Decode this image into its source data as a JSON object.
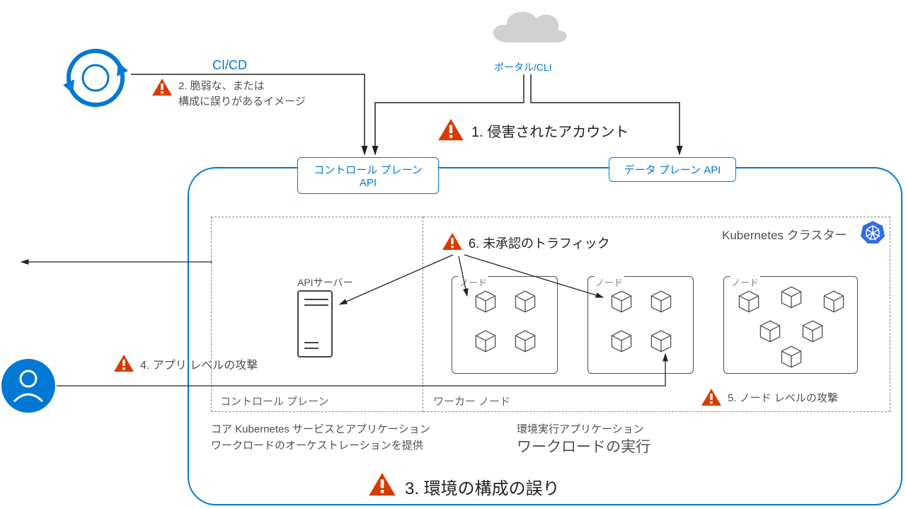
{
  "top": {
    "cicd_label": "CI/CD",
    "portal_label": "ポータル/CLI"
  },
  "threats": {
    "t1": "1. 侵害されたアカウント",
    "t2_line1": "2. 脆弱な、または",
    "t2_line2": "構成に誤りがあるイメージ",
    "t3": "3. 環境の構成の誤り",
    "t4": "4. アプリ レベルの攻撃",
    "t5": "5. ノード レベルの攻撃",
    "t6": "6. 未承認のトラフィック"
  },
  "apis": {
    "control": "コントロール プレーン API",
    "data": "データ プレーン API"
  },
  "cluster": {
    "title": "Kubernetes クラスター",
    "api_server": "APIサーバー",
    "node": "ノード",
    "control_plane_section": "コントロール プレーン",
    "worker_section": "ワーカー ノード"
  },
  "descriptions": {
    "control_line1": "コア Kubernetes サービスとアプリケーション",
    "control_line2": "ワークロードのオーケストレーションを提供",
    "worker_line1": "環境実行アプリケーション",
    "worker_line2": "ワークロードの実行"
  }
}
